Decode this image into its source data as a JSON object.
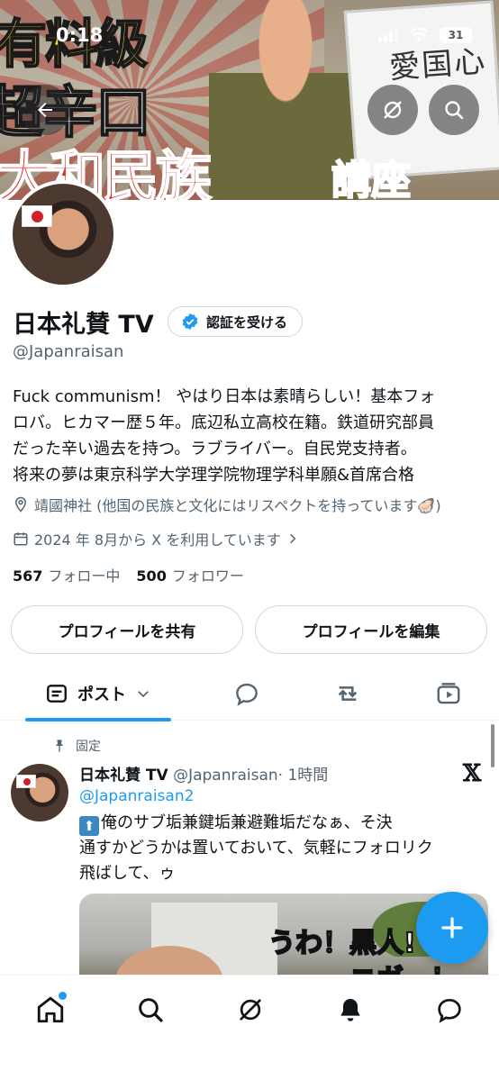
{
  "status_bar": {
    "time": "0:18",
    "battery": "31"
  },
  "banner": {
    "line1": "有料級",
    "line2": "超辛口",
    "line3": "大和民族",
    "line4": "講座",
    "whiteboard_text": "愛国心"
  },
  "profile": {
    "display_name": "日本礼賛 TV",
    "verify_button": "認証を受ける",
    "handle": "@Japanraisan",
    "bio_lines": [
      "Fuck communism！ やはり日本は素晴らしい！基本フォ",
      "ロバ。ヒカマー歴５年。底辺私立高校在籍。鉄道研究部員",
      "だった辛い過去を持つ。ラブライバー。自民党支持者。",
      "将来の夢は東京科学大学理学院物理学科単願&首席合格"
    ],
    "location": "靖國神社 (他国の民族と文化にはリスペクトを持っています🦪)",
    "joined": "2024 年 8月から X を利用しています",
    "following_count": "567",
    "following_label": "フォロー中",
    "followers_count": "500",
    "followers_label": "フォロワー",
    "share_button": "プロフィールを共有",
    "edit_button": "プロフィールを編集"
  },
  "tabs": {
    "posts_label": "ポスト"
  },
  "post": {
    "pinned_label": "固定",
    "author_name": "日本礼賛 TV",
    "author_handle": "@Japanraisan",
    "time": "· 1時間",
    "mention": "@Japanraisan2",
    "text_lines": [
      "俺のサブ垢兼鍵垢兼避難垢だなぁ、そ決",
      "通すかどうかは置いておいて、気軽にフォロリク",
      "飛ばして、ゥ"
    ],
    "media_text_1": "うわ！黒人!",
    "media_text_2": "ニガー！"
  },
  "colors": {
    "accent": "#1d9bf0",
    "text": "#0f1419",
    "secondary": "#536471",
    "border": "#cfd9de"
  },
  "icons": [
    "back-arrow-icon",
    "grok-icon",
    "search-icon",
    "verified-badge-icon",
    "location-icon",
    "calendar-icon",
    "chevron-right-icon",
    "pin-icon",
    "x-logo-icon",
    "plus-icon",
    "home-icon",
    "bell-icon",
    "messages-icon",
    "reply-icon",
    "repost-icon",
    "media-icon"
  ]
}
